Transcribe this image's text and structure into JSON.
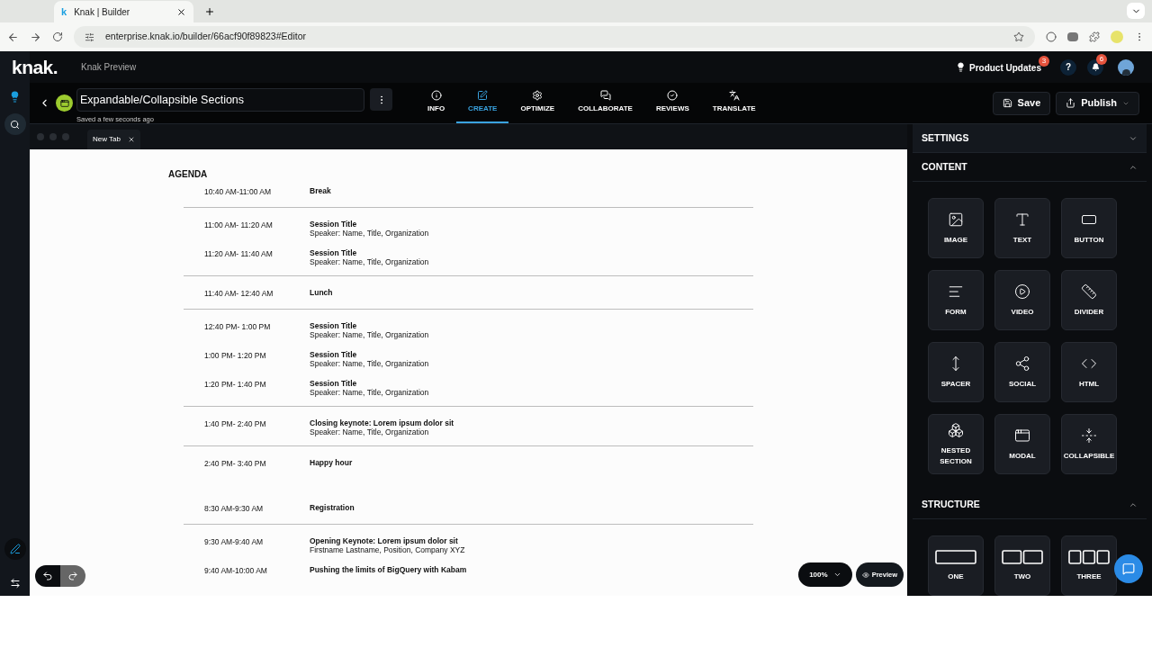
{
  "browser": {
    "favicon": "k",
    "tab_title": "Knak | Builder",
    "url": "enterprise.knak.io/builder/66acf90f89823#Editor"
  },
  "header": {
    "brand": "knak.",
    "workspace": "Knak Preview",
    "product_updates": "Product Updates",
    "updates_badge": "3",
    "help": "?",
    "notifications_badge": "6"
  },
  "editor": {
    "title": "Expandable/Collapsible Sections",
    "saved": "Saved a few seconds ago",
    "nav": [
      {
        "label": "INFO",
        "selected": false
      },
      {
        "label": "CREATE",
        "selected": true
      },
      {
        "label": "OPTIMIZE",
        "selected": false
      },
      {
        "label": "COLLABORATE",
        "selected": false
      },
      {
        "label": "REVIEWS",
        "selected": false
      },
      {
        "label": "TRANSLATE",
        "selected": false
      }
    ],
    "save": "Save",
    "publish": "Publish"
  },
  "canvas": {
    "tab": "New Tab",
    "heading": "AGENDA",
    "zoom": "100%",
    "preview": "Preview",
    "groups": [
      {
        "divider_before": false,
        "rows": [
          {
            "time": "10:40 AM-11:00 AM",
            "title": "Break"
          }
        ]
      },
      {
        "divider_before": true,
        "rows": [
          {
            "time": "11:00 AM- 11:20 AM",
            "title": "Session Title",
            "detail": "Speaker: Name, Title, Organization"
          },
          {
            "time": "11:20 AM- 11:40 AM",
            "title": "Session Title",
            "detail": "Speaker: Name, Title, Organization"
          }
        ]
      },
      {
        "divider_before": true,
        "rows": [
          {
            "time": "11:40 AM- 12:40 AM",
            "title": "Lunch"
          }
        ]
      },
      {
        "divider_before": true,
        "rows": [
          {
            "time": "12:40 PM- 1:00 PM",
            "title": "Session Title",
            "detail": "Speaker: Name, Title, Organization"
          },
          {
            "time": "1:00 PM- 1:20 PM",
            "title": "Session Title",
            "detail": "Speaker: Name, Title, Organization"
          },
          {
            "time": "1:20 PM- 1:40 PM",
            "title": "Session Title",
            "detail": "Speaker: Name, Title, Organization"
          }
        ]
      },
      {
        "divider_before": true,
        "rows": [
          {
            "time": "1:40 PM- 2:40 PM",
            "title": "Closing keynote: Lorem ipsum dolor sit",
            "detail": "Speaker: Name, Title, Organization"
          }
        ]
      },
      {
        "divider_before": true,
        "rows": [
          {
            "time": "2:40 PM- 3:40 PM",
            "title": "Happy hour"
          }
        ]
      },
      {
        "divider_before": false,
        "rows": [
          {
            "time": "8:30 AM-9:30 AM",
            "title": "Registration"
          }
        ]
      },
      {
        "divider_before": true,
        "rows": [
          {
            "time": "9:30 AM-9:40 AM",
            "title": "Opening Keynote: Lorem ipsum dolor sit",
            "detail": "Firstname Lastname, Position, Company XYZ"
          },
          {
            "time": "9:40 AM-10:00 AM",
            "title": "Pushing the limits of BigQuery with Kabam"
          }
        ]
      }
    ]
  },
  "panel": {
    "sections": [
      {
        "title": "SETTINGS",
        "expanded": false
      },
      {
        "title": "CONTENT",
        "expanded": true,
        "items": [
          "IMAGE",
          "TEXT",
          "BUTTON",
          "FORM",
          "VIDEO",
          "DIVIDER",
          "SPACER",
          "SOCIAL",
          "HTML",
          "NESTED SECTION",
          "MODAL",
          "COLLAPSIBLE"
        ]
      },
      {
        "title": "STRUCTURE",
        "expanded": true,
        "items": [
          "ONE",
          "TWO",
          "THREE"
        ]
      }
    ]
  }
}
